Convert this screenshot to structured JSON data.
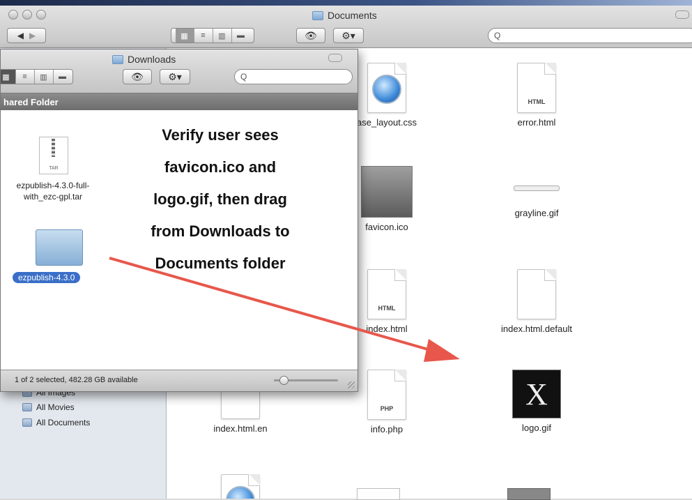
{
  "documents_window": {
    "title": "Documents",
    "search_placeholder": "Q",
    "sidebar": [
      {
        "label": "All Images",
        "icon": "folder-icon"
      },
      {
        "label": "All Movies",
        "icon": "folder-icon"
      },
      {
        "label": "All Documents",
        "icon": "folder-icon"
      }
    ],
    "files": [
      {
        "label": "ase_layout.css",
        "icon": "css-file-icon"
      },
      {
        "label": "error.html",
        "icon": "html-file-icon",
        "tag": "HTML"
      },
      {
        "label": "favicon.ico",
        "icon": "apple-icon"
      },
      {
        "label": "grayline.gif",
        "icon": "gif-image-icon"
      },
      {
        "label": "index.html",
        "icon": "html-file-icon",
        "tag": "HTML"
      },
      {
        "label": "index.html.default",
        "icon": "document-icon"
      },
      {
        "label": "index.html.en",
        "icon": "document-icon"
      },
      {
        "label": "info.php",
        "icon": "php-file-icon",
        "tag": "PHP"
      },
      {
        "label": "logo.gif",
        "icon": "x-logo-icon",
        "glyph": "X"
      }
    ]
  },
  "downloads_window": {
    "title": "Downloads",
    "section_header": "hared Folder",
    "search_placeholder": "Q",
    "files": [
      {
        "label_line1": "ezpublish-4.3.0-full-",
        "label_line2": "with_ezc-gpl.tar",
        "tag": "TAR"
      },
      {
        "label": "ezpublish-4.3.0",
        "selected": true
      }
    ],
    "status": "1 of 2 selected, 482.28 GB available"
  },
  "instruction": {
    "lines": [
      "Verify user sees",
      "favicon.ico and",
      "logo.gif, then drag",
      "from Downloads to",
      "Documents folder"
    ]
  },
  "colors": {
    "arrow": "#e8574b",
    "selection": "#3a6fc8"
  }
}
